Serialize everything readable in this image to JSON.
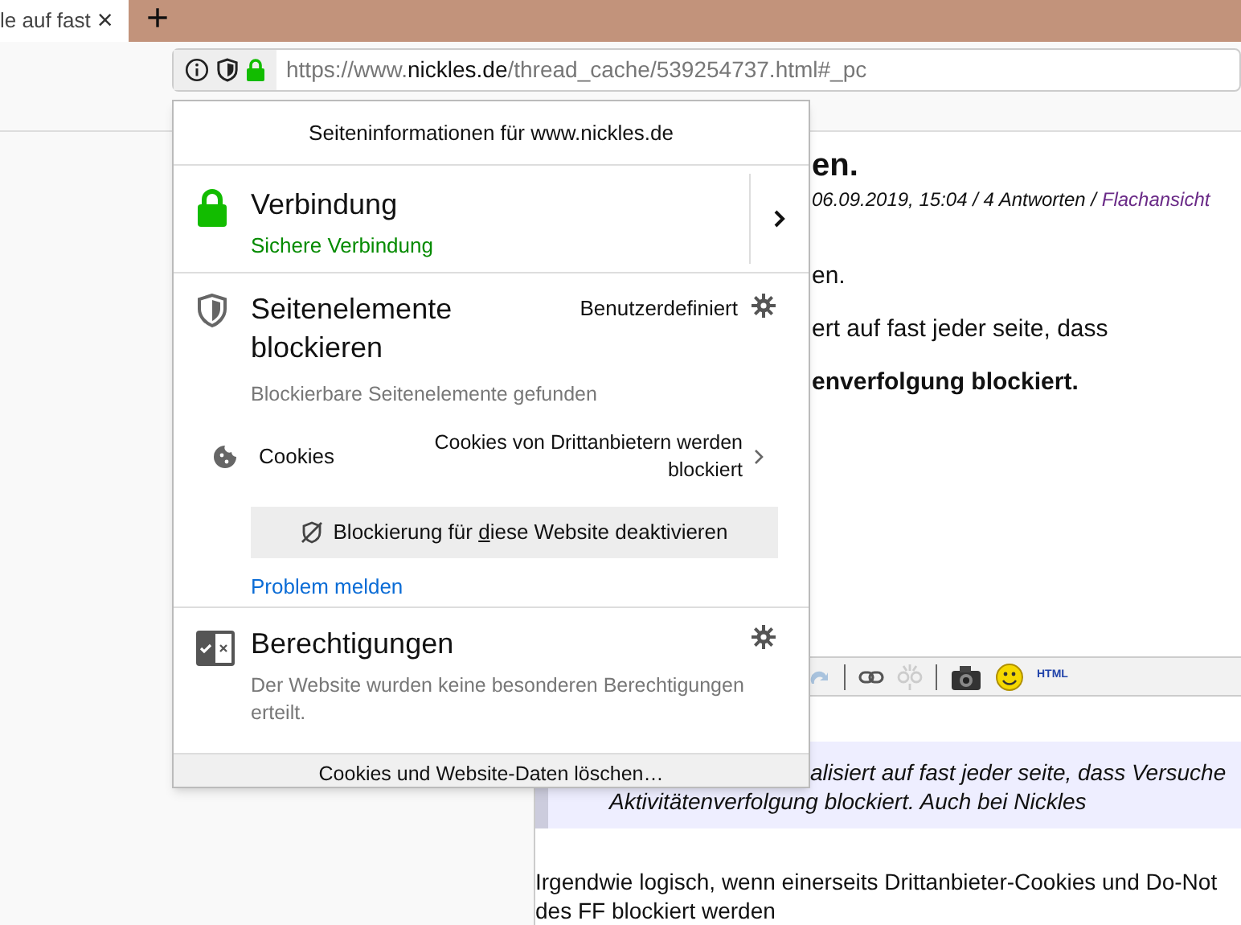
{
  "tab": {
    "title": "le auf fast",
    "close": "×",
    "new_tab": "+"
  },
  "address_bar": {
    "url_prefix": "https://www.",
    "url_host": "nickles.de",
    "url_path": "/thread_cache/539254737.html#_pc",
    "secure": true
  },
  "page": {
    "heading": "en.",
    "meta": "06.09.2019, 15:04 / 4 Antworten / ",
    "meta_link": "Flachansicht",
    "lines": [
      {
        "text": "en.",
        "bold": false
      },
      {
        "text": "ert auf fast jeder seite, dass",
        "bold": false
      },
      {
        "text": "enverfolgung blockiert.",
        "bold": true
      }
    ],
    "toolbar_label": "HTML",
    "quote": [
      "alisiert auf fast jeder seite, dass Versuche",
      "Aktivitätenverfolgung blockiert. Auch bei Nickles"
    ],
    "body": [
      "Irgendwie logisch, wenn einerseits Drittanbieter-Cookies und Do-Not",
      "des FF blockiert werden"
    ]
  },
  "popup": {
    "title": "Seiteninformationen für www.nickles.de",
    "connection": {
      "title": "Verbindung",
      "status": "Sichere Verbindung",
      "secure": true
    },
    "blocking": {
      "title": "Seitenelemente blockieren",
      "mode": "Benutzerdefiniert",
      "subtitle": "Blockierbare Seitenelemente gefunden",
      "items": [
        {
          "label": "Cookies",
          "status": "Cookies von Drittanbietern werden blockiert"
        }
      ],
      "button": "Blockierung für **d**iese Website deaktivieren",
      "link": "Problem melden"
    },
    "permissions": {
      "title": "Berechtigungen",
      "text": "Der Website wurden keine besonderen Berechtigungen erteilt."
    },
    "footer": "Cookies und Website-Daten löschen…"
  }
}
